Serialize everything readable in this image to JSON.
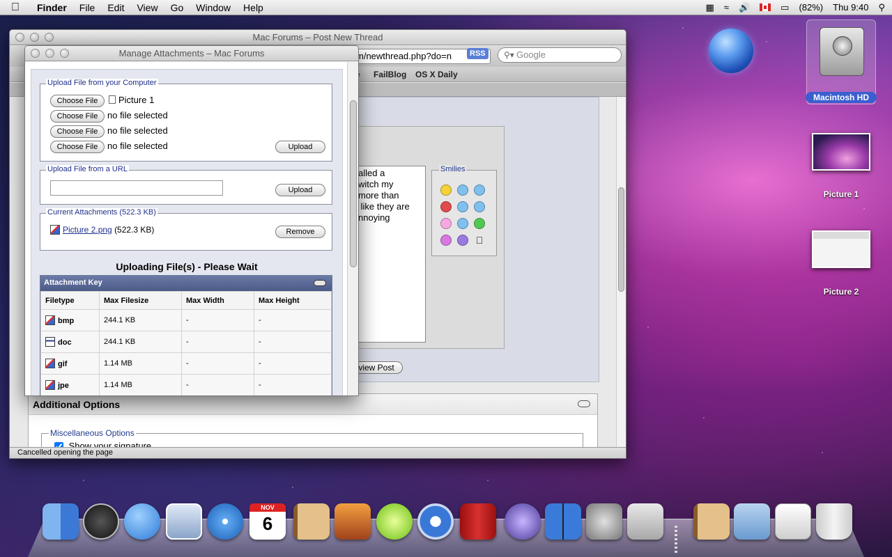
{
  "menubar": {
    "apple": "",
    "items": [
      "Finder",
      "File",
      "Edit",
      "View",
      "Go",
      "Window",
      "Help"
    ],
    "battery": "(82%)",
    "clock": "Thu 9:40"
  },
  "browser": {
    "title": "Mac Forums – Post New Thread",
    "url": "m/newthread.php?do=n",
    "rss": "RSS",
    "search_placeholder": "Google",
    "bookmarks": [
      "e",
      "FailBlog",
      "OS X Daily"
    ],
    "editor_text": "alled a\nwitch my\nmore than\n like they are\nnnoying",
    "smilies_legend": "Smilies",
    "preview_button": "view Post",
    "additional_options": "Additional Options",
    "misc_options": "Miscellaneous Options",
    "show_signature": "Show your signature",
    "status": "Cancelled opening the page"
  },
  "attachments": {
    "title": "Manage Attachments – Mac Forums",
    "upload_computer": {
      "legend": "Upload File from your Computer",
      "choose_label": "Choose File",
      "files": [
        "Picture 1",
        "no file selected",
        "no file selected",
        "no file selected"
      ],
      "upload_label": "Upload"
    },
    "upload_url": {
      "legend": "Upload File from a URL",
      "value": "",
      "upload_label": "Upload"
    },
    "current": {
      "legend": "Current Attachments (522.3 KB)",
      "file_link": "Picture 2.png",
      "file_size": "(522.3 KB)",
      "remove_label": "Remove"
    },
    "uploading_text": "Uploading File(s) - Please Wait",
    "key": {
      "title": "Attachment Key",
      "headers": [
        "Filetype",
        "Max Filesize",
        "Max Width",
        "Max Height"
      ],
      "rows": [
        {
          "type": "bmp",
          "size": "244.1 KB",
          "width": "-",
          "height": "-"
        },
        {
          "type": "doc",
          "size": "244.1 KB",
          "width": "-",
          "height": "-"
        },
        {
          "type": "gif",
          "size": "1.14 MB",
          "width": "-",
          "height": "-"
        },
        {
          "type": "jpe",
          "size": "1.14 MB",
          "width": "-",
          "height": "-"
        }
      ]
    }
  },
  "desktop": {
    "hd_label": "Macintosh HD",
    "picture1_label": "Picture 1",
    "picture2_label": "Picture 2"
  },
  "dock": {
    "icons": [
      "finder-icon",
      "dashboard-icon",
      "ichat-icon",
      "mail-icon",
      "safari-icon",
      "ical-icon",
      "address-book-icon",
      "iphoto-icon",
      "limewire-icon",
      "itunes-icon",
      "photo-booth-icon",
      "preview-icon",
      "spaces-icon",
      "system-preferences-icon",
      "nes-icon",
      "applications-stack-icon",
      "documents-stack-icon",
      "downloads-stack-icon",
      "trash-icon"
    ],
    "ical_month": "NOV",
    "ical_day": "6"
  }
}
